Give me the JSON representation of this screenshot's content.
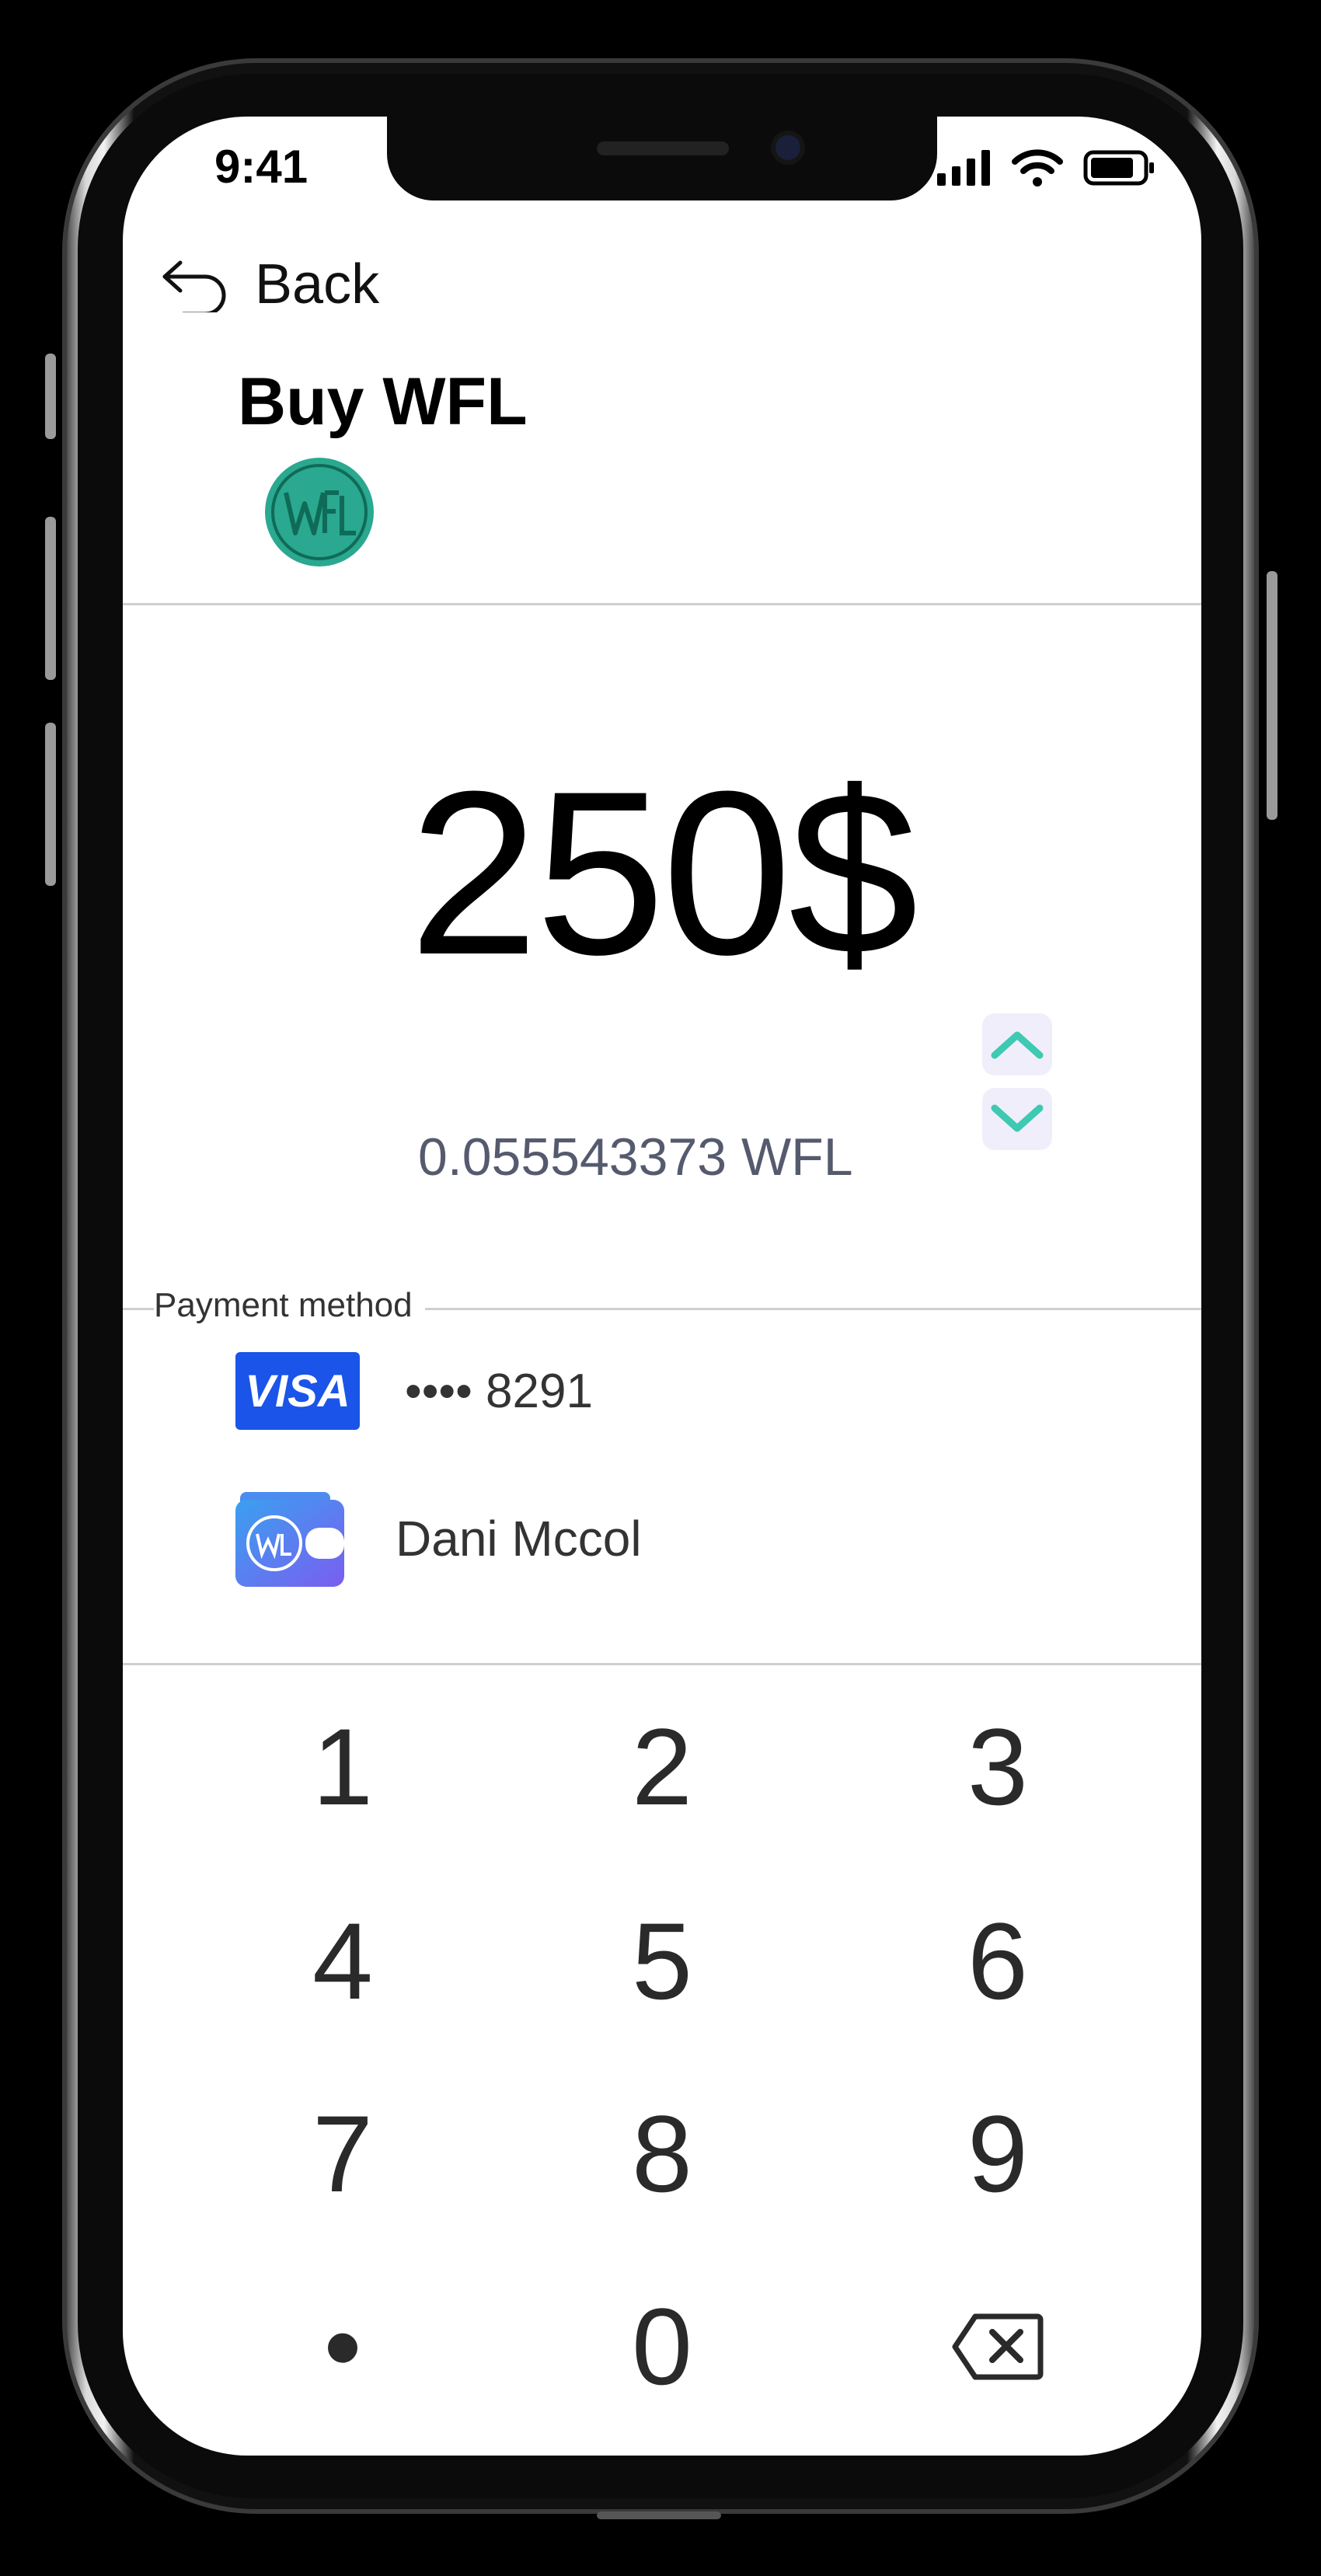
{
  "status_bar": {
    "time": "9:41"
  },
  "nav": {
    "back_label": "Back"
  },
  "header": {
    "title": "Buy WFL",
    "coin_icon": "wfl-coin-icon"
  },
  "amount": {
    "fiat": "250$",
    "crypto": "0.055543373 WFL"
  },
  "payment": {
    "section_label": "Payment method",
    "methods": [
      {
        "brand": "VISA",
        "label": "•••• 8291"
      },
      {
        "brand": "wfl-wallet",
        "label": "Dani Mccol"
      }
    ]
  },
  "keypad": {
    "keys": [
      "1",
      "2",
      "3",
      "4",
      "5",
      "6",
      "7",
      "8",
      "9",
      "•",
      "0",
      "backspace"
    ]
  },
  "colors": {
    "accent": "#2aa890",
    "chevron": "#3ec9b3",
    "visa": "#1a54e8",
    "wallet": "#5b7cf0"
  }
}
